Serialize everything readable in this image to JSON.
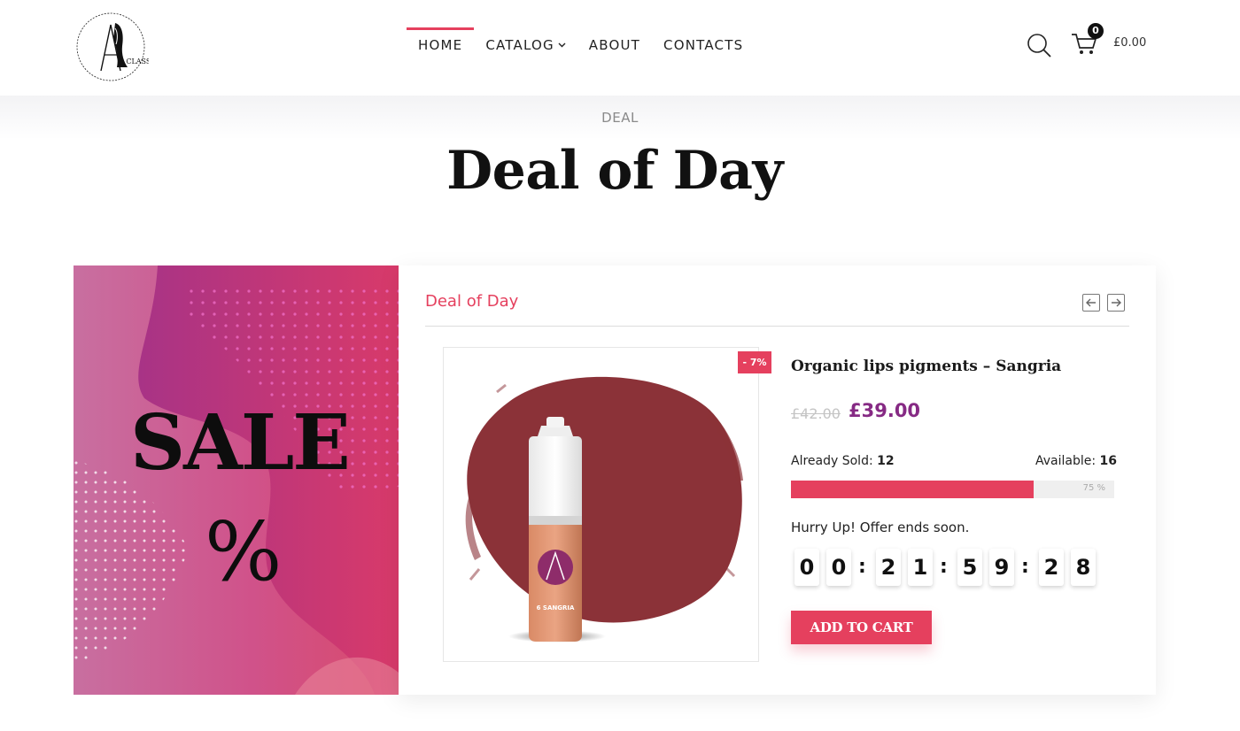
{
  "header": {
    "logo_text": "A CLASS",
    "nav": [
      {
        "label": "HOME",
        "active": true
      },
      {
        "label": "CATALOG",
        "has_dropdown": true
      },
      {
        "label": "ABOUT"
      },
      {
        "label": "CONTACTS"
      }
    ],
    "cart_count": "0",
    "cart_total": "£0.00",
    "icons": {
      "search": "search-icon",
      "cart": "cart-icon",
      "dropdown": "chevron-down-icon"
    }
  },
  "hero": {
    "eyebrow": "DEAL",
    "title": "Deal of Day"
  },
  "banner": {
    "sale_word": "SALE",
    "percent_sign": "%"
  },
  "deal": {
    "section_title": "Deal of Day",
    "nav_icons": [
      "arrow-left-icon",
      "arrow-right-icon"
    ],
    "product": {
      "name": "Organic lips pigments – Sangria",
      "discount_badge": "- 7%",
      "old_price": "£42.00",
      "new_price": "£39.00",
      "bottle_label": "6 SANGRIA",
      "sold_label": "Already Sold:",
      "sold_value": "12",
      "available_label": "Available:",
      "available_value": "16",
      "progress_percent": 75,
      "progress_text": "75 %",
      "hurry_text": "Hurry Up! Offer ends soon.",
      "countdown": [
        "0",
        "0",
        "2",
        "1",
        "5",
        "9",
        "2",
        "8"
      ],
      "countdown_separator": ":",
      "add_to_cart": "ADD TO CART"
    }
  },
  "colors": {
    "accent": "#e5405e",
    "price": "#862a84",
    "swatch": "#8b3238"
  }
}
